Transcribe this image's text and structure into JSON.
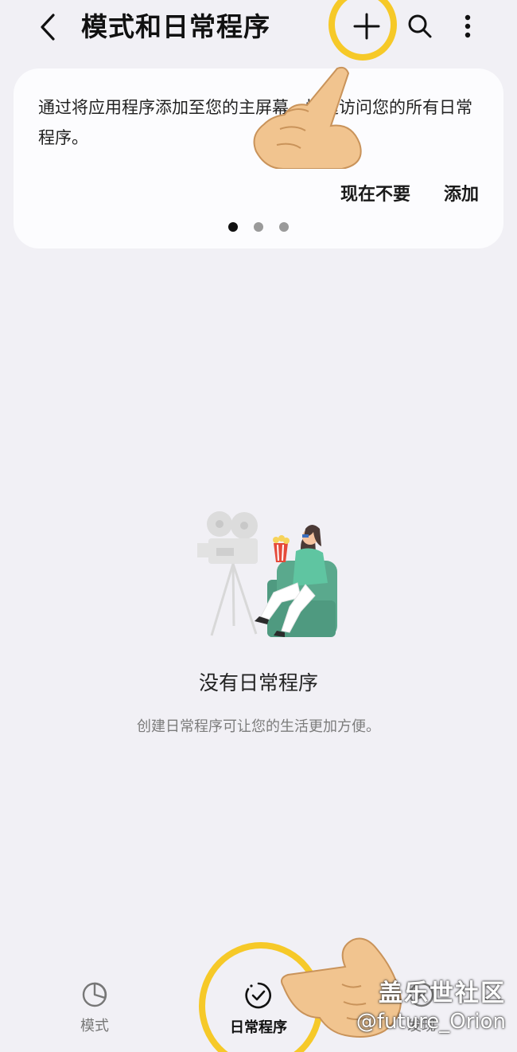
{
  "header": {
    "title": "模式和日常程序",
    "back_icon": "chevron-left-icon",
    "add_icon": "plus-icon",
    "search_icon": "search-icon",
    "more_icon": "more-vertical-icon"
  },
  "promo_card": {
    "text": "通过将应用程序添加至您的主屏幕，快速访问您的所有日常程序。",
    "dismiss_label": "现在不要",
    "add_label": "添加",
    "page_count": 3,
    "active_page": 1
  },
  "empty_state": {
    "illustration": "movie-viewer-illustration",
    "title": "没有日常程序",
    "description": "创建日常程序可让您的生活更加方便。"
  },
  "bottom_nav": {
    "items": [
      {
        "label": "模式",
        "icon": "pie-chart-icon",
        "active": false
      },
      {
        "label": "日常程序",
        "icon": "check-clock-icon",
        "active": true
      },
      {
        "label": "发现",
        "icon": "compass-icon",
        "active": false
      }
    ]
  },
  "overlay": {
    "highlight_color": "#f6c928",
    "watermark_logo": "盖乐世社区",
    "watermark_user": "@future_Orion"
  }
}
